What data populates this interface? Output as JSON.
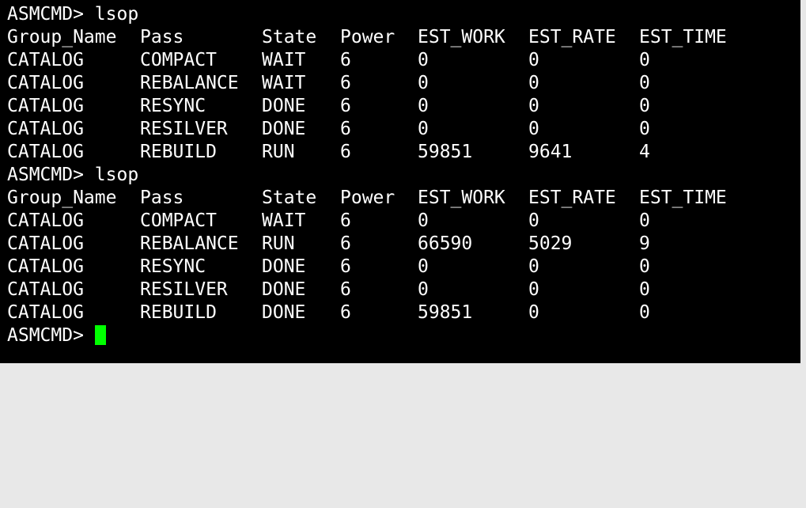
{
  "terminal": {
    "background": "#000000",
    "foreground": "#ffffff",
    "cursor_color": "#00ff00",
    "prompt": "ASMCMD>",
    "blocks": [
      {
        "command": "lsop",
        "headers": [
          "Group_Name",
          "Pass",
          "State",
          "Power",
          "EST_WORK",
          "EST_RATE",
          "EST_TIME"
        ],
        "rows": [
          [
            "CATALOG",
            "COMPACT",
            "WAIT",
            "6",
            "0",
            "0",
            "0"
          ],
          [
            "CATALOG",
            "REBALANCE",
            "WAIT",
            "6",
            "0",
            "0",
            "0"
          ],
          [
            "CATALOG",
            "RESYNC",
            "DONE",
            "6",
            "0",
            "0",
            "0"
          ],
          [
            "CATALOG",
            "RESILVER",
            "DONE",
            "6",
            "0",
            "0",
            "0"
          ],
          [
            "CATALOG",
            "REBUILD",
            "RUN",
            "6",
            "59851",
            "9641",
            "4"
          ]
        ]
      },
      {
        "command": "lsop",
        "headers": [
          "Group_Name",
          "Pass",
          "State",
          "Power",
          "EST_WORK",
          "EST_RATE",
          "EST_TIME"
        ],
        "rows": [
          [
            "CATALOG",
            "COMPACT",
            "WAIT",
            "6",
            "0",
            "0",
            "0"
          ],
          [
            "CATALOG",
            "REBALANCE",
            "RUN",
            "6",
            "66590",
            "5029",
            "9"
          ],
          [
            "CATALOG",
            "RESYNC",
            "DONE",
            "6",
            "0",
            "0",
            "0"
          ],
          [
            "CATALOG",
            "RESILVER",
            "DONE",
            "6",
            "0",
            "0",
            "0"
          ],
          [
            "CATALOG",
            "REBUILD",
            "DONE",
            "6",
            "59851",
            "0",
            "0"
          ]
        ]
      }
    ],
    "final_prompt": "ASMCMD>"
  }
}
